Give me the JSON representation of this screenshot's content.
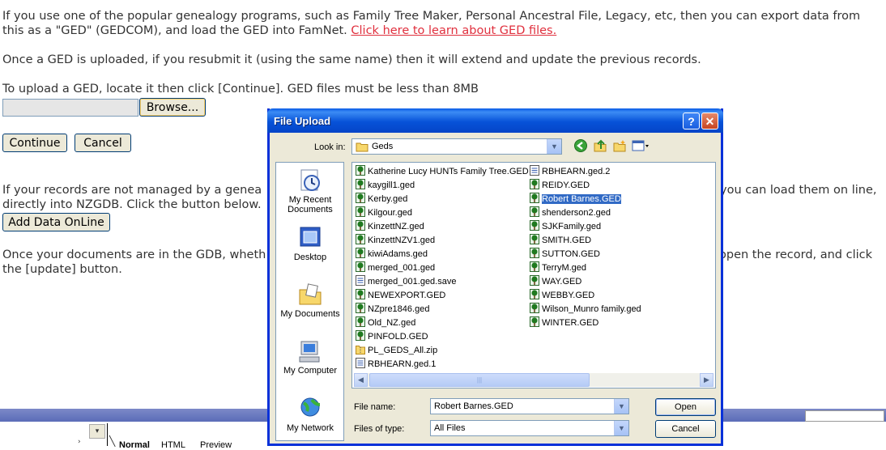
{
  "page": {
    "para1_line1": "If you use one of the popular genealogy programs, such as Family Tree Maker, Personal Ancestral File, Legacy, etc, then you can export data from",
    "para1_line2": "this as a \"GED\" (GEDCOM), and load the GED into FamNet. ",
    "para1_link": "Click here to learn about GED files.",
    "para2": "Once a GED is uploaded, if you resubmit it (using the same name) then it will extend and update the previous records.",
    "para3": "To upload a GED, locate it then click [Continue]. GED files must be less than 8MB",
    "browse_label": "Browse...",
    "continue_label": "Continue",
    "cancel_label": "Cancel",
    "para4_line1_left": "If your records are not managed by a genea",
    "para4_line1_right": "you can load them on line,",
    "para4_line2": "directly into NZGDB. Click the button below.",
    "add_data_label": "Add Data OnLine",
    "para5_line1_left": "Once your documents are in the GDB, wheth",
    "para5_line1_right": "open the record, and click",
    "para5_line2": "the [update] button."
  },
  "editor": {
    "tabs": [
      "Normal",
      "HTML",
      "Preview"
    ]
  },
  "dialog": {
    "title": "File Upload",
    "help": "?",
    "close": "✕",
    "look_in_label": "Look in:",
    "look_in_value": "Geds",
    "places": [
      "My Recent Documents",
      "Desktop",
      "My Documents",
      "My Computer",
      "My Network"
    ],
    "files_col1": [
      {
        "name": "Katherine Lucy HUNTs Family Tree.GED",
        "type": "ged"
      },
      {
        "name": "kaygill1.ged",
        "type": "ged"
      },
      {
        "name": "Kerby.ged",
        "type": "ged"
      },
      {
        "name": "Kilgour.ged",
        "type": "ged"
      },
      {
        "name": "KinzettNZ.ged",
        "type": "ged"
      },
      {
        "name": "KinzettNZV1.ged",
        "type": "ged"
      },
      {
        "name": "kiwiAdams.ged",
        "type": "ged"
      },
      {
        "name": "merged_001.ged",
        "type": "ged"
      },
      {
        "name": "merged_001.ged.save",
        "type": "doc"
      },
      {
        "name": "NEWEXPORT.GED",
        "type": "ged"
      },
      {
        "name": "NZpre1846.ged",
        "type": "ged"
      },
      {
        "name": "Old_NZ.ged",
        "type": "ged"
      },
      {
        "name": "PINFOLD.GED",
        "type": "ged"
      },
      {
        "name": "PL_GEDS_All.zip",
        "type": "zip"
      },
      {
        "name": "RBHEARN.ged.1",
        "type": "doc"
      }
    ],
    "files_col2": [
      {
        "name": "RBHEARN.ged.2",
        "type": "doc"
      },
      {
        "name": "REIDY.GED",
        "type": "ged"
      },
      {
        "name": "Robert Barnes.GED",
        "type": "ged",
        "selected": true
      },
      {
        "name": "shenderson2.ged",
        "type": "ged"
      },
      {
        "name": "SJKFamily.ged",
        "type": "ged"
      },
      {
        "name": "SMITH.GED",
        "type": "ged"
      },
      {
        "name": "SUTTON.GED",
        "type": "ged"
      },
      {
        "name": "TerryM.ged",
        "type": "ged"
      },
      {
        "name": "WAY.GED",
        "type": "ged"
      },
      {
        "name": "WEBBY.GED",
        "type": "ged"
      },
      {
        "name": "Wilson_Munro family.ged",
        "type": "ged"
      },
      {
        "name": "WINTER.GED",
        "type": "ged"
      }
    ],
    "file_name_label": "File name:",
    "file_name_value": "Robert Barnes.GED",
    "files_of_type_label": "Files of type:",
    "files_of_type_value": "All Files",
    "open_label": "Open",
    "cancel_label": "Cancel"
  },
  "colors": {
    "title_bar": "#0752d8",
    "link": "#e0303e",
    "selection": "#316ac5",
    "dialog_face": "#ece9d8"
  }
}
